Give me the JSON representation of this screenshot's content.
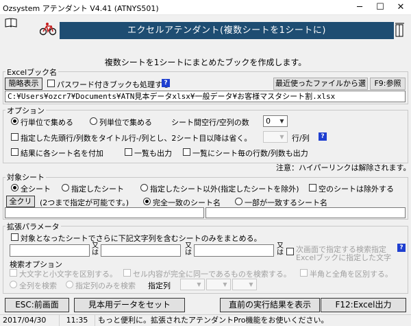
{
  "window": {
    "title": "Ozsystem アテンダント V4.41 (ATNYS501)",
    "minimize": "─",
    "maximize": "☐",
    "close": "✕"
  },
  "banner": "エクセルアテンダント(複数シートを1シートに)",
  "description": "複数シートを1シートにまとめたブックを作成します。",
  "excel_book": {
    "label": "Excelブック名",
    "show_short": "簡略表示",
    "process_password": "パスワード付きブックも処理する",
    "help": "?",
    "recent_files": "最近使ったファイルから選択",
    "browse": "F9:参照",
    "path": "C:¥Users¥ozcr7¥Documents¥ATN見本データxlsx¥一般データ¥お客様マスタシート割.xlsx"
  },
  "options": {
    "label": "オプション",
    "by_row": "行単位で集める",
    "by_col": "列単位で集める",
    "gap_label": "シート間空行/空列の数",
    "gap_value": "0",
    "title_row_opt": "指定した先頭行/列数をタイトル行-/列とし、2シート目以降は省く。",
    "row_col": "行/列",
    "help": "?",
    "add_sheet_name": "結果に各シート名を付加",
    "output_list": "一覧も出力",
    "output_counts": "一覧にシート毎の行数/列数も出力",
    "note": "注意：ハイパーリンクは解除されます。"
  },
  "target_sheet": {
    "label": "対象シート",
    "all": "全シート",
    "specified": "指定したシート",
    "except_specified": "指定したシート以外(指定したシートを除外)",
    "exclude_empty": "空のシートは除外する",
    "clear_all": "全クリア",
    "max_two": "(2つまで指定が可能です。)",
    "exact_match": "完全一致のシート名",
    "partial_match": "一部が一致するシート名"
  },
  "extended": {
    "label": "拡張パラメータ",
    "only_containing": "対象となったシートでさらに下記文字列を含むシートのみをまとめる。",
    "or_label": "又は",
    "next_screen": "次画面で指定する検索指定",
    "book_specified": "Excelブックに指定した文字",
    "help": "?",
    "search_options": "検索オプション",
    "case_sensitive": "大文字と小文字を区別する。",
    "exact_cell": "セル内容が完全に同一であるものを検索する。",
    "full_half": "半角と全角を区別する。",
    "search_all_cols": "全列を検索",
    "search_specified_cols": "指定列のみを検索",
    "specified_col": "指定列"
  },
  "buttons": {
    "esc": "ESC:前画面",
    "sample": "見本用データをセット",
    "last_result": "直前の実行結果を表示",
    "f12": "F12:Excel出力"
  },
  "status": {
    "date": "2017/04/30",
    "time": "11:35",
    "message": "もっと便利に。拡張されたアテンダントPro機能をお使いください。"
  },
  "colors": {
    "banner": "#1e4d72",
    "help": "#1f3fd0"
  },
  "icons": {
    "app": "app-icon",
    "book": "book-icon",
    "bicycle": "bicycle-icon",
    "door": "door-icon"
  }
}
